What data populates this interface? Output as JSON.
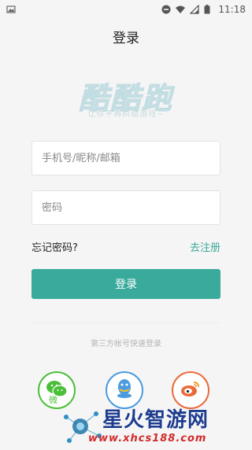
{
  "status_bar": {
    "time": "11:18"
  },
  "header": {
    "title": "登录"
  },
  "brand": {
    "logo_text": "酷酷跑",
    "slogan": "让你不再纠结游戏~"
  },
  "form": {
    "account_placeholder": "手机号/昵称/邮箱",
    "password_placeholder": "密码",
    "forgot_label": "忘记密码?",
    "register_label": "去注册",
    "login_label": "登录"
  },
  "third_party": {
    "label": "第三方帐号快速登录",
    "providers": [
      {
        "name": "wechat",
        "icon": "wechat-icon",
        "color": "#4cbf3a"
      },
      {
        "name": "qq",
        "icon": "qq-icon",
        "color": "#4a9be0"
      },
      {
        "name": "weibo",
        "icon": "weibo-icon",
        "color": "#ea6a3a"
      }
    ],
    "wechat_caption": "微"
  },
  "watermark": {
    "title": "星火智游网",
    "url": "www.xhcs188.com"
  }
}
